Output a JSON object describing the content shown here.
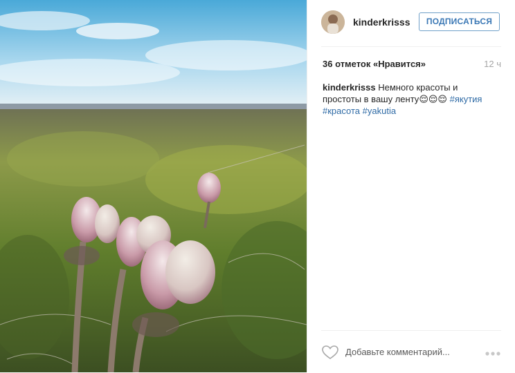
{
  "post": {
    "username": "kinderkrisss",
    "follow_label": "ПОДПИСАТЬСЯ",
    "likes_text": "36 отметок «Нравится»",
    "time": "12 ч",
    "caption": {
      "username": "kinderkrisss",
      "text": "Немного красоты и простоты в вашу ленту",
      "emoji": "😌😌😌",
      "tags": [
        "#якутия",
        "#красота",
        "#yakutia"
      ]
    },
    "comment_placeholder": "Добавьте комментарий...",
    "icons": {
      "like": "heart-outline-icon",
      "more": "more-options-icon"
    },
    "colors": {
      "link": "#2e6aa5",
      "follow_border": "#70a0c8",
      "follow_text": "#3b78b5"
    }
  }
}
